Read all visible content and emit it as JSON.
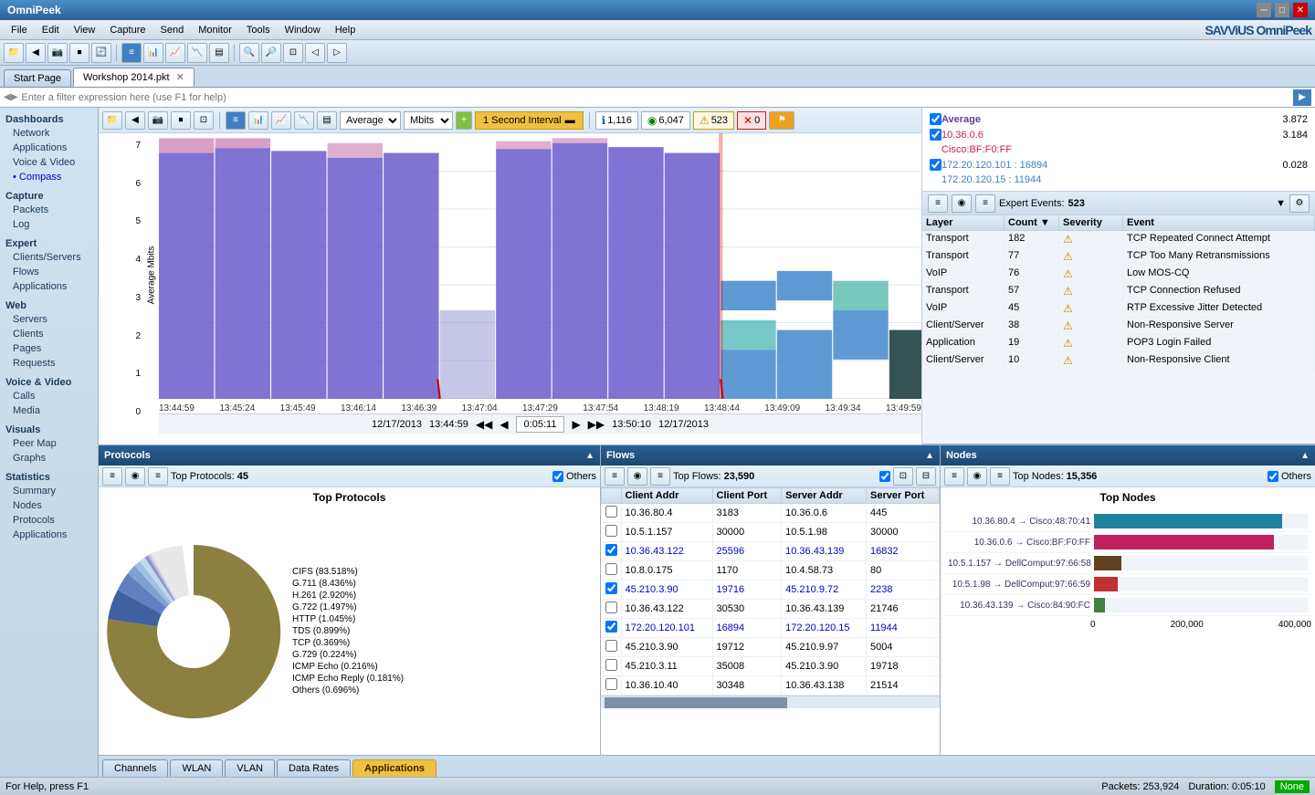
{
  "app": {
    "title": "OmniPeek",
    "logo": "SAVViUS OmniPeek"
  },
  "titlebar": {
    "title": "OmniPeek",
    "min_label": "─",
    "max_label": "□",
    "close_label": "✕"
  },
  "menubar": {
    "items": [
      "File",
      "Edit",
      "View",
      "Capture",
      "Send",
      "Monitor",
      "Tools",
      "Window",
      "Help"
    ]
  },
  "tabs": [
    {
      "label": "Start Page",
      "active": false
    },
    {
      "label": "Workshop 2014.pkt",
      "active": true
    }
  ],
  "filter_placeholder": "Enter a filter expression here (use F1 for help)",
  "sidebar": {
    "dashboards": {
      "section": "Dashboards",
      "items": [
        "Network",
        "Applications",
        "Voice & Video",
        "• Compass"
      ]
    },
    "capture": {
      "section": "Capture",
      "items": [
        "Packets",
        "Log"
      ]
    },
    "expert": {
      "section": "Expert",
      "items": [
        "Clients/Servers",
        "Flows",
        "Applications"
      ]
    },
    "web": {
      "section": "Web",
      "items": [
        "Servers",
        "Clients",
        "Pages",
        "Requests"
      ]
    },
    "voice": {
      "section": "Voice & Video",
      "items": [
        "Calls",
        "Media"
      ]
    },
    "visuals": {
      "section": "Visuals",
      "items": [
        "Peer Map",
        "Graphs"
      ]
    },
    "statistics": {
      "section": "Statistics",
      "items": [
        "Summary",
        "Nodes",
        "Protocols",
        "Applications"
      ]
    }
  },
  "graph_toolbar": {
    "average_label": "Average",
    "mbits_label": "Mbits",
    "interval_label": "1 Second Interval",
    "second_interval_label": "Second Interval",
    "packets_count": "1,116",
    "bytes_count": "6,047",
    "warn_count": "523",
    "err_count": "0",
    "alert_icon": "⚠"
  },
  "graph": {
    "y_label": "Average Mbits",
    "y_max": "7",
    "y_values": [
      "7",
      "6",
      "5",
      "4",
      "3",
      "2",
      "1",
      "0"
    ],
    "x_labels": [
      "13:44:59",
      "13:45:24",
      "13:45:49",
      "13:46:14",
      "13:46:39",
      "13:47:04",
      "13:47:29",
      "13:47:54",
      "13:48:19",
      "13:48:44",
      "13:49:09",
      "13:49:34",
      "13:49:59"
    ],
    "time_start": "13:44:59",
    "time_end": "12/17/2013",
    "time_current": "0:05:11",
    "time_current2": "13:50:10",
    "date": "12/17/2013"
  },
  "legend": {
    "items": [
      {
        "label": "Average",
        "color": "#6040a0",
        "checked": true,
        "value": "3.872"
      },
      {
        "label": "10.36.0.6",
        "color": "#c02060",
        "checked": true,
        "value": "3.184"
      },
      {
        "label": "Cisco:BF:F0:FF",
        "color": "#c02060",
        "checked": true,
        "value": ""
      },
      {
        "label": "172.20.120.101 : 16894",
        "color": "#4080c0",
        "checked": true,
        "value": "0.028"
      },
      {
        "label": "172.20.120.15 : 11944",
        "color": "#4080c0",
        "checked": true,
        "value": ""
      }
    ]
  },
  "expert": {
    "title": "Expert Events:",
    "count": "523",
    "columns": [
      "Layer",
      "Count ▼",
      "Severity",
      "Event"
    ],
    "rows": [
      {
        "layer": "Transport",
        "count": "182",
        "severity": "warn",
        "event": "TCP Repeated Connect Attempt"
      },
      {
        "layer": "Transport",
        "count": "77",
        "severity": "warn",
        "event": "TCP Too Many Retransmissions"
      },
      {
        "layer": "VoIP",
        "count": "76",
        "severity": "warn",
        "event": "Low MOS-CQ"
      },
      {
        "layer": "Transport",
        "count": "57",
        "severity": "warn",
        "event": "TCP Connection Refused"
      },
      {
        "layer": "VoIP",
        "count": "45",
        "severity": "warn",
        "event": "RTP Excessive Jitter Detected"
      },
      {
        "layer": "Client/Server",
        "count": "38",
        "severity": "warn",
        "event": "Non-Responsive Server"
      },
      {
        "layer": "Application",
        "count": "19",
        "severity": "warn",
        "event": "POP3 Login Failed"
      },
      {
        "layer": "Client/Server",
        "count": "10",
        "severity": "warn",
        "event": "Non-Responsive Client"
      }
    ]
  },
  "protocols": {
    "title": "Protocols",
    "top_count": "45",
    "chart_title": "Top Protocols",
    "others_checked": true,
    "slices": [
      {
        "label": "CIFS (83.518%)",
        "color": "#8B8040",
        "percent": 83.518
      },
      {
        "label": "G.711 (8.436%)",
        "color": "#4060a0",
        "percent": 8.436
      },
      {
        "label": "H.261 (2.920%)",
        "color": "#6080c0",
        "percent": 2.92
      },
      {
        "label": "G.722 (1.497%)",
        "color": "#80a0d0",
        "percent": 1.497
      },
      {
        "label": "HTTP (1.045%)",
        "color": "#a0c0e0",
        "percent": 1.045
      },
      {
        "label": "TDS (0.899%)",
        "color": "#c0d8f0",
        "percent": 0.899
      },
      {
        "label": "TCP (0.369%)",
        "color": "#9090c0",
        "percent": 0.369
      },
      {
        "label": "G.729 (0.224%)",
        "color": "#b0b0d8",
        "percent": 0.224
      },
      {
        "label": "ICMP Echo (0.216%)",
        "color": "#d0d0e8",
        "percent": 0.216
      },
      {
        "label": "ICMP Echo Reply (0.181%)",
        "color": "#e0e0f0",
        "percent": 0.181
      },
      {
        "label": "Others (0.696%)",
        "color": "#e8e8e8",
        "percent": 0.696
      }
    ]
  },
  "flows": {
    "title": "Flows",
    "top_count": "23,590",
    "others_checked": true,
    "columns": [
      "Client Addr",
      "Client Port",
      "Server Addr",
      "Server Port"
    ],
    "rows": [
      {
        "client_addr": "10.36.80.4",
        "client_port": "3183",
        "server_addr": "10.36.0.6",
        "server_port": "445",
        "checked": false
      },
      {
        "client_addr": "10.5.1.157",
        "client_port": "30000",
        "server_addr": "10.5.1.98",
        "server_port": "30000",
        "checked": false
      },
      {
        "client_addr": "10.36.43.122",
        "client_port": "25596",
        "server_addr": "10.36.43.139",
        "server_port": "16832",
        "checked": true
      },
      {
        "client_addr": "10.8.0.175",
        "client_port": "1170",
        "server_addr": "10.4.58.73",
        "server_port": "80",
        "checked": false
      },
      {
        "client_addr": "45.210.3.90",
        "client_port": "19716",
        "server_addr": "45.210.9.72",
        "server_port": "2238",
        "checked": true
      },
      {
        "client_addr": "10.36.43.122",
        "client_port": "30530",
        "server_addr": "10.36.43.139",
        "server_port": "21746",
        "checked": false
      },
      {
        "client_addr": "172.20.120.101",
        "client_port": "16894",
        "server_addr": "172.20.120.15",
        "server_port": "11944",
        "checked": true
      },
      {
        "client_addr": "45.210.3.90",
        "client_port": "19712",
        "server_addr": "45.210.9.97",
        "server_port": "5004",
        "checked": false
      },
      {
        "client_addr": "45.210.3.11",
        "client_port": "35008",
        "server_addr": "45.210.3.90",
        "server_port": "19718",
        "checked": false
      },
      {
        "client_addr": "10.36.10.40",
        "client_port": "30348",
        "server_addr": "10.36.43.138",
        "server_port": "21514",
        "checked": false
      }
    ]
  },
  "nodes": {
    "title": "Nodes",
    "top_count": "15,356",
    "chart_title": "Top Nodes",
    "others_checked": true,
    "x_labels": [
      "0",
      "200,000",
      "400,000"
    ],
    "bars": [
      {
        "label": "10.36.80.4 → Cisco:48:70:41",
        "color": "#2080a0",
        "value": 420000,
        "max": 480000
      },
      {
        "label": "10.36.0.6 → Cisco:BF:F0:FF",
        "color": "#c02060",
        "value": 400000,
        "max": 480000
      },
      {
        "label": "10.5.1.157 → DellComput:97:66:58",
        "color": "#604020",
        "value": 60000,
        "max": 480000
      },
      {
        "label": "10.5.1.98 → DellComput:97:66:59",
        "color": "#c03030",
        "value": 50000,
        "max": 480000
      },
      {
        "label": "10.36.43.139 → Cisco:84:90:FC",
        "color": "#408040",
        "value": 20000,
        "max": 480000
      }
    ]
  },
  "bottom_tabs": {
    "items": [
      "Channels",
      "WLAN",
      "VLAN",
      "Data Rates",
      "Applications"
    ],
    "active": "Applications"
  },
  "statusbar": {
    "left": "For Help, press F1",
    "packets": "Packets: 253,924",
    "duration": "Duration: 0:05:10",
    "status": "None"
  }
}
